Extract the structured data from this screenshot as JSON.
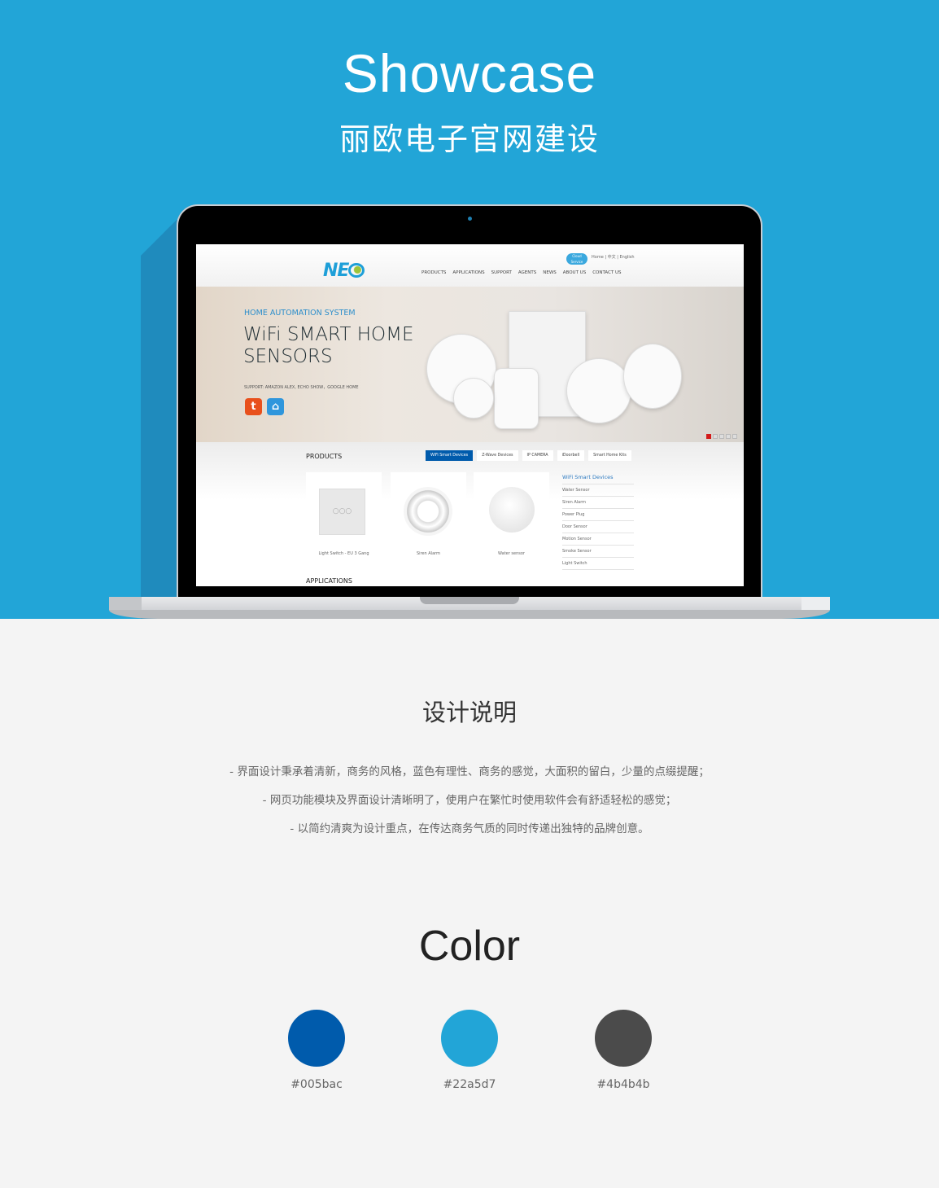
{
  "header": {
    "title": "Showcase",
    "subtitle": "丽欧电子官网建设"
  },
  "site": {
    "logo": "NEO",
    "cloud_badge": "Cloud Service",
    "top_links": "Home | 中文 | English",
    "nav": [
      "PRODUCTS",
      "APPLICATIONS",
      "SUPPORT",
      "AGENTS",
      "NEWS",
      "ABOUT US",
      "CONTACT US"
    ],
    "hero": {
      "kicker": "HOME AUTOMATION SYSTEM",
      "title": "WiFi SMART HOME SENSORS",
      "support": "SUPPORT: AMAZON ALEX, ECHO SHOW，GOOGLE HOME",
      "slide_count": 5,
      "active_slide": 1,
      "app_icons": [
        "tuya-icon",
        "smart-life-icon"
      ]
    },
    "products": {
      "title": "PRODUCTS",
      "tabs": [
        "WiFi Smart Devices",
        "Z-Wave Devices",
        "IP CAMERA",
        "iDoorbell",
        "Smart Home Kits"
      ],
      "active_tab": 0,
      "cards": [
        "Light Switch - EU 3 Gang",
        "Siren Alarm",
        "Water sensor"
      ],
      "sidebar_title": "WiFi Smart Devices",
      "sidebar_items": [
        "Water Sensor",
        "Siren Alarm",
        "Power Plug",
        "Door Sensor",
        "Motion Sensor",
        "Smoke Sensor",
        "Light Switch"
      ]
    },
    "applications_title": "APPLICATIONS"
  },
  "design": {
    "title": "设计说明",
    "lines": [
      "- 界面设计秉承着清新，商务的风格，蓝色有理性、商务的感觉，大面积的留白，少量的点缀提醒；",
      "- 网页功能模块及界面设计清晰明了，使用户在繁忙时使用软件会有舒适轻松的感觉；",
      "- 以简约清爽为设计重点，在传达商务气质的同时传递出独特的品牌创意。"
    ]
  },
  "color": {
    "title": "Color",
    "swatches": [
      {
        "hex": "#005bac",
        "label": "#005bac"
      },
      {
        "hex": "#22a5d7",
        "label": "#22a5d7"
      },
      {
        "hex": "#4b4b4b",
        "label": "#4b4b4b"
      }
    ]
  }
}
